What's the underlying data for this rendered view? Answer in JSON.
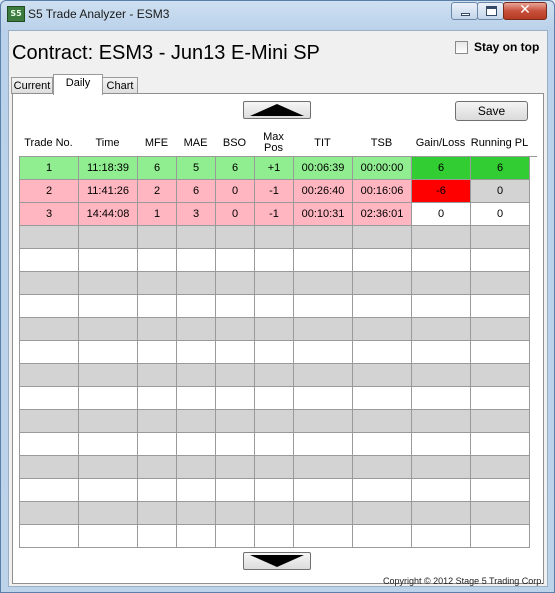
{
  "window": {
    "title": "S5 Trade Analyzer - ESM3",
    "app_icon_text": "S5"
  },
  "header": {
    "contract": "Contract: ESM3 - Jun13 E-Mini SP",
    "stay_on_top_label": "Stay on top",
    "stay_on_top_checked": false
  },
  "tabs": [
    {
      "label": "Current",
      "active": false
    },
    {
      "label": "Daily",
      "active": true
    },
    {
      "label": "Chart",
      "active": false
    }
  ],
  "toolbar": {
    "save_label": "Save",
    "scroll_up_icon": "triangle-up-icon",
    "scroll_down_icon": "triangle-down-icon"
  },
  "table": {
    "columns": [
      "Trade No.",
      "Time",
      "MFE",
      "MAE",
      "BSO",
      "Max Pos",
      "TIT",
      "TSB",
      "Gain/Loss",
      "Running PL"
    ],
    "rows": [
      {
        "status": "win",
        "cells": [
          "1",
          "11:18:39",
          "6",
          "5",
          "6",
          "+1",
          "00:06:39",
          "00:00:00",
          "6",
          "6"
        ],
        "gain_color": "green",
        "pl_color": "green"
      },
      {
        "status": "loss",
        "cells": [
          "2",
          "11:41:26",
          "2",
          "6",
          "0",
          "-1",
          "00:26:40",
          "00:16:06",
          "-6",
          "0"
        ],
        "gain_color": "red",
        "pl_color": "grey"
      },
      {
        "status": "loss",
        "cells": [
          "3",
          "14:44:08",
          "1",
          "3",
          "0",
          "-1",
          "00:10:31",
          "02:36:01",
          "0",
          "0"
        ],
        "gain_color": "white",
        "pl_color": "white"
      }
    ],
    "empty_rows": 14
  },
  "colors": {
    "win_row": "#90ee90",
    "loss_row": "#ffb6c1",
    "gain_highlight": "#32cd32",
    "loss_highlight": "#ff0000",
    "stripe": "#d3d3d3"
  },
  "footer": {
    "copyright": "Copyright © 2012 Stage 5 Trading Corp."
  }
}
